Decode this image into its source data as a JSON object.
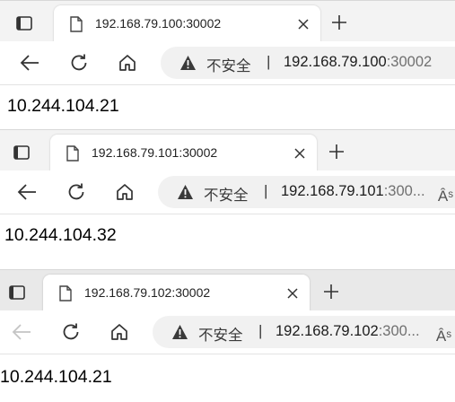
{
  "windows": [
    {
      "tab_title": "192.168.79.100:30002",
      "security_label": "不安全",
      "separator": "|",
      "url_host": "192.168.79.100",
      "url_rest": ":30002",
      "read_aloud": "",
      "content": "10.244.104.21",
      "back_enabled": true
    },
    {
      "tab_title": "192.168.79.101:30002",
      "security_label": "不安全",
      "separator": "|",
      "url_host": "192.168.79.101",
      "url_rest": ":300...",
      "read_aloud": "Âˢ",
      "content": "10.244.104.32",
      "back_enabled": true
    },
    {
      "tab_title": "192.168.79.102:30002",
      "security_label": "不安全",
      "separator": "|",
      "url_host": "192.168.79.102",
      "url_rest": ":300...",
      "read_aloud": "Âˢ",
      "content": "10.244.104.21",
      "back_enabled": false
    }
  ],
  "icons": {
    "tab_actions": "tab-actions-icon",
    "page": "page-icon",
    "close": "close-icon",
    "new_tab": "plus-icon",
    "back": "back-arrow-icon",
    "refresh": "refresh-icon",
    "home": "home-icon",
    "warning": "warning-triangle-icon",
    "read_aloud": "read-aloud-icon"
  }
}
